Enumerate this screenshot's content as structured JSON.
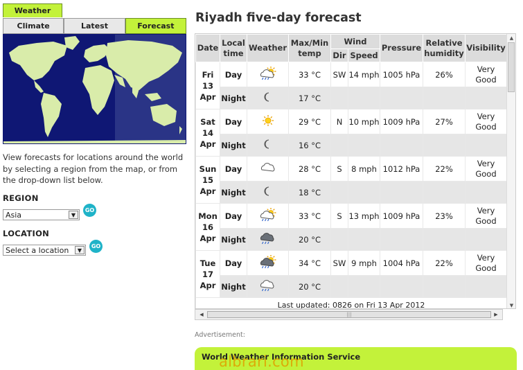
{
  "nav": {
    "main_tab": "Weather",
    "subtabs": [
      {
        "label": "Climate",
        "active": false
      },
      {
        "label": "Latest",
        "active": false
      },
      {
        "label": "Forecast",
        "active": true
      }
    ]
  },
  "sidebar": {
    "description": "View forecasts for locations around the world by selecting a region from the map, or from the drop-down list below.",
    "region_label": "REGION",
    "region_value": "Asia",
    "region_go": "GO",
    "location_label": "LOCATION",
    "location_value": "Select a location",
    "location_go": "GO"
  },
  "forecast": {
    "title": "Riyadh five-day forecast",
    "headers": {
      "date": "Date",
      "local_time": "Local time",
      "weather": "Weather",
      "maxmin": "Max/Min temp",
      "wind": "Wind",
      "dir": "Dir",
      "speed": "Speed",
      "pressure": "Pressure",
      "humidity": "Relative humidity",
      "visibility": "Visibility"
    },
    "days": [
      {
        "dayname": "Fri",
        "daynum": "13",
        "month": "Apr",
        "day": {
          "label": "Day",
          "icon": "sun-cloud-rain-icon",
          "temp": "33 °C",
          "dir": "SW",
          "speed": "14 mph",
          "pressure": "1005 hPa",
          "humidity": "26%",
          "vis1": "Very",
          "vis2": "Good"
        },
        "night": {
          "label": "Night",
          "icon": "moon-icon",
          "temp": "17 °C"
        }
      },
      {
        "dayname": "Sat",
        "daynum": "14",
        "month": "Apr",
        "day": {
          "label": "Day",
          "icon": "sun-icon",
          "temp": "29 °C",
          "dir": "N",
          "speed": "10 mph",
          "pressure": "1009 hPa",
          "humidity": "27%",
          "vis1": "Very",
          "vis2": "Good"
        },
        "night": {
          "label": "Night",
          "icon": "moon-icon",
          "temp": "16 °C"
        }
      },
      {
        "dayname": "Sun",
        "daynum": "15",
        "month": "Apr",
        "day": {
          "label": "Day",
          "icon": "cloud-icon",
          "temp": "28 °C",
          "dir": "S",
          "speed": "8 mph",
          "pressure": "1012 hPa",
          "humidity": "22%",
          "vis1": "Very",
          "vis2": "Good"
        },
        "night": {
          "label": "Night",
          "icon": "moon-icon",
          "temp": "18 °C"
        }
      },
      {
        "dayname": "Mon",
        "daynum": "16",
        "month": "Apr",
        "day": {
          "label": "Day",
          "icon": "sun-cloud-rain-icon",
          "temp": "33 °C",
          "dir": "S",
          "speed": "13 mph",
          "pressure": "1009 hPa",
          "humidity": "23%",
          "vis1": "Very",
          "vis2": "Good"
        },
        "night": {
          "label": "Night",
          "icon": "dark-cloud-rain-icon",
          "temp": "20 °C"
        }
      },
      {
        "dayname": "Tue",
        "daynum": "17",
        "month": "Apr",
        "day": {
          "label": "Day",
          "icon": "sun-dark-cloud-rain-icon",
          "temp": "34 °C",
          "dir": "SW",
          "speed": "9 mph",
          "pressure": "1004 hPa",
          "humidity": "22%",
          "vis1": "Very",
          "vis2": "Good"
        },
        "night": {
          "label": "Night",
          "icon": "cloud-rain-icon",
          "temp": "20 °C"
        }
      }
    ],
    "last_updated": "Last updated: 0826 on Fri 13 Apr 2012"
  },
  "footer": {
    "advertisement": "Advertisement:",
    "wwis_title": "World Weather Information Service",
    "watermark": "albrari.com"
  },
  "colors": {
    "accent_green": "#c3f23a",
    "map_ocean": "#0f1774",
    "map_land": "#d9ecaa",
    "go_button": "#1fb3c8",
    "header_gray": "#dcdcdc"
  }
}
